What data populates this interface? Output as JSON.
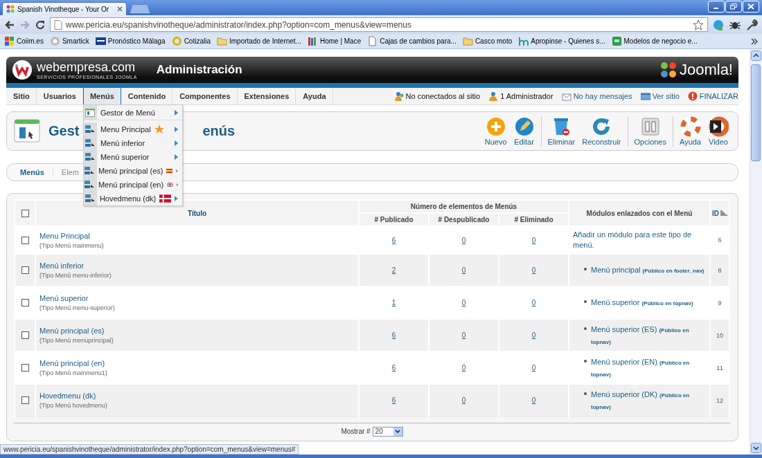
{
  "browser": {
    "tab_title": "Spanish Vinotheque - Your Or",
    "forward_enabled": false,
    "url": "www.pericia.eu/spanishvinotheque/administrator/index.php?option=com_menus&view=menus",
    "bookmarks": [
      {
        "label": "Coiim.es",
        "kind": "tiles"
      },
      {
        "label": "Smartick",
        "kind": "badge"
      },
      {
        "label": "Pronóstico Málaga",
        "kind": "tile"
      },
      {
        "label": "Cotizalia",
        "kind": "ring"
      },
      {
        "label": "Importado de Internet...",
        "kind": "folder"
      },
      {
        "label": "Home | Mace",
        "kind": "books"
      },
      {
        "label": "Cajas de cambios para...",
        "kind": "page"
      },
      {
        "label": "Casco moto",
        "kind": "folder"
      },
      {
        "label": "Apropinse - Quienes s...",
        "kind": "arch"
      },
      {
        "label": "Modelos de negocio e...",
        "kind": "leaf"
      }
    ]
  },
  "header": {
    "brand": "webempresa.com",
    "tagline": "SERVICIOS PROFESIONALES JOOMLA",
    "title": "Administración",
    "logo_text": "Joomla!"
  },
  "menu": [
    {
      "label": "Sitio",
      "selected": false
    },
    {
      "label": "Usuarios",
      "selected": false
    },
    {
      "label": "Menús",
      "selected": true
    },
    {
      "label": "Contenido",
      "selected": false
    },
    {
      "label": "Componentes",
      "selected": false
    },
    {
      "label": "Extensiones",
      "selected": false
    },
    {
      "label": "Ayuda",
      "selected": false
    }
  ],
  "menu_dropdown": [
    {
      "label": "Gestor de Menú",
      "kind": "manager"
    },
    {
      "label": "Menu Principal",
      "kind": "home"
    },
    {
      "label": "Menú inferior",
      "kind": "plain"
    },
    {
      "label": "Menú superior",
      "kind": "plain"
    },
    {
      "label": "Menú principal (es)",
      "kind": "es"
    },
    {
      "label": "Menú principal (en)",
      "kind": "en"
    },
    {
      "label": "Hovedmenu (dk)",
      "kind": "dk"
    }
  ],
  "status_items": [
    {
      "label": "No conectados al sitio",
      "kind": "users"
    },
    {
      "label": "1 Administrador",
      "kind": "admin"
    },
    {
      "label": "No hay mensajes",
      "kind": "messages"
    },
    {
      "label": "Ver sitio",
      "kind": "site"
    },
    {
      "label": "FINALIZAR",
      "kind": "logout"
    }
  ],
  "toolbar": {
    "title_parts": [
      "Gest",
      "enús"
    ],
    "buttons": [
      {
        "label": "Nuevo",
        "kind": "new",
        "separator_before": false
      },
      {
        "label": "Editar",
        "kind": "edit",
        "separator_before": false
      },
      {
        "label": "Eliminar",
        "kind": "delete",
        "separator_before": true
      },
      {
        "label": "Reconstruir",
        "kind": "rebuild",
        "separator_before": false
      },
      {
        "label": "Opciones",
        "kind": "options",
        "separator_before": true
      },
      {
        "label": "Ayuda",
        "kind": "help",
        "separator_before": true
      },
      {
        "label": "Video",
        "kind": "video",
        "separator_before": false
      }
    ]
  },
  "subtabs": [
    {
      "label": "Menús",
      "selected": true
    },
    {
      "label": "Elem",
      "selected": false
    }
  ],
  "table": {
    "select_all_checked": false,
    "headers": {
      "title": "Título",
      "group": "Número de elementos de Menús",
      "published": "# Publicado",
      "unpublished": "# Despublicado",
      "trashed": "# Eliminado",
      "modules": "Módulos enlazados con el Menú",
      "id": "ID"
    },
    "rows": [
      {
        "checked": false,
        "title": "Menu Principal",
        "type": "(Tipo Menú mainmenu)",
        "published": "6",
        "unpublished": "0",
        "trashed": "0",
        "add_module": "Añadir un módulo para este tipo de menú.",
        "id": "6"
      },
      {
        "checked": false,
        "title": "Menú inferior",
        "type": "(Tipo Menú menu-inferior)",
        "published": "2",
        "unpublished": "0",
        "trashed": "0",
        "modules": [
          {
            "name": "Menú principal",
            "detail": "(Público en footer_nav)"
          }
        ],
        "id": "8"
      },
      {
        "checked": false,
        "title": "Menú superior",
        "type": "(Tipo Menú menu-superior)",
        "published": "1",
        "unpublished": "0",
        "trashed": "0",
        "modules": [
          {
            "name": "Menú superior",
            "detail": "(Público en topnav)"
          }
        ],
        "id": "9"
      },
      {
        "checked": false,
        "title": "Menú principal (es)",
        "type": "(Tipo Menú menuprincipal)",
        "published": "6",
        "unpublished": "0",
        "trashed": "0",
        "modules": [
          {
            "name": "Menú superior (ES)",
            "detail": "(Público en topnav)"
          }
        ],
        "id": "10"
      },
      {
        "checked": false,
        "title": "Menú principal (en)",
        "type": "(Tipo Menú mainmenu1)",
        "published": "6",
        "unpublished": "0",
        "trashed": "0",
        "modules": [
          {
            "name": "Menú superior (EN)",
            "detail": "(Público en topnav)"
          }
        ],
        "id": "11"
      },
      {
        "checked": false,
        "title": "Hovedmenu (dk)",
        "type": "(Tipo Menú hovedmenu)",
        "published": "6",
        "unpublished": "0",
        "trashed": "0",
        "modules": [
          {
            "name": "Menú superior (DK)",
            "detail": "(Público en topnav)"
          }
        ],
        "id": "12"
      }
    ],
    "page_size": {
      "label": "Mostrar #",
      "value": "20"
    }
  },
  "status_bar": {
    "url": "www.pericia.eu/spanishvinotheque/administrator/index.php?option=com_menus&view=menus#"
  }
}
